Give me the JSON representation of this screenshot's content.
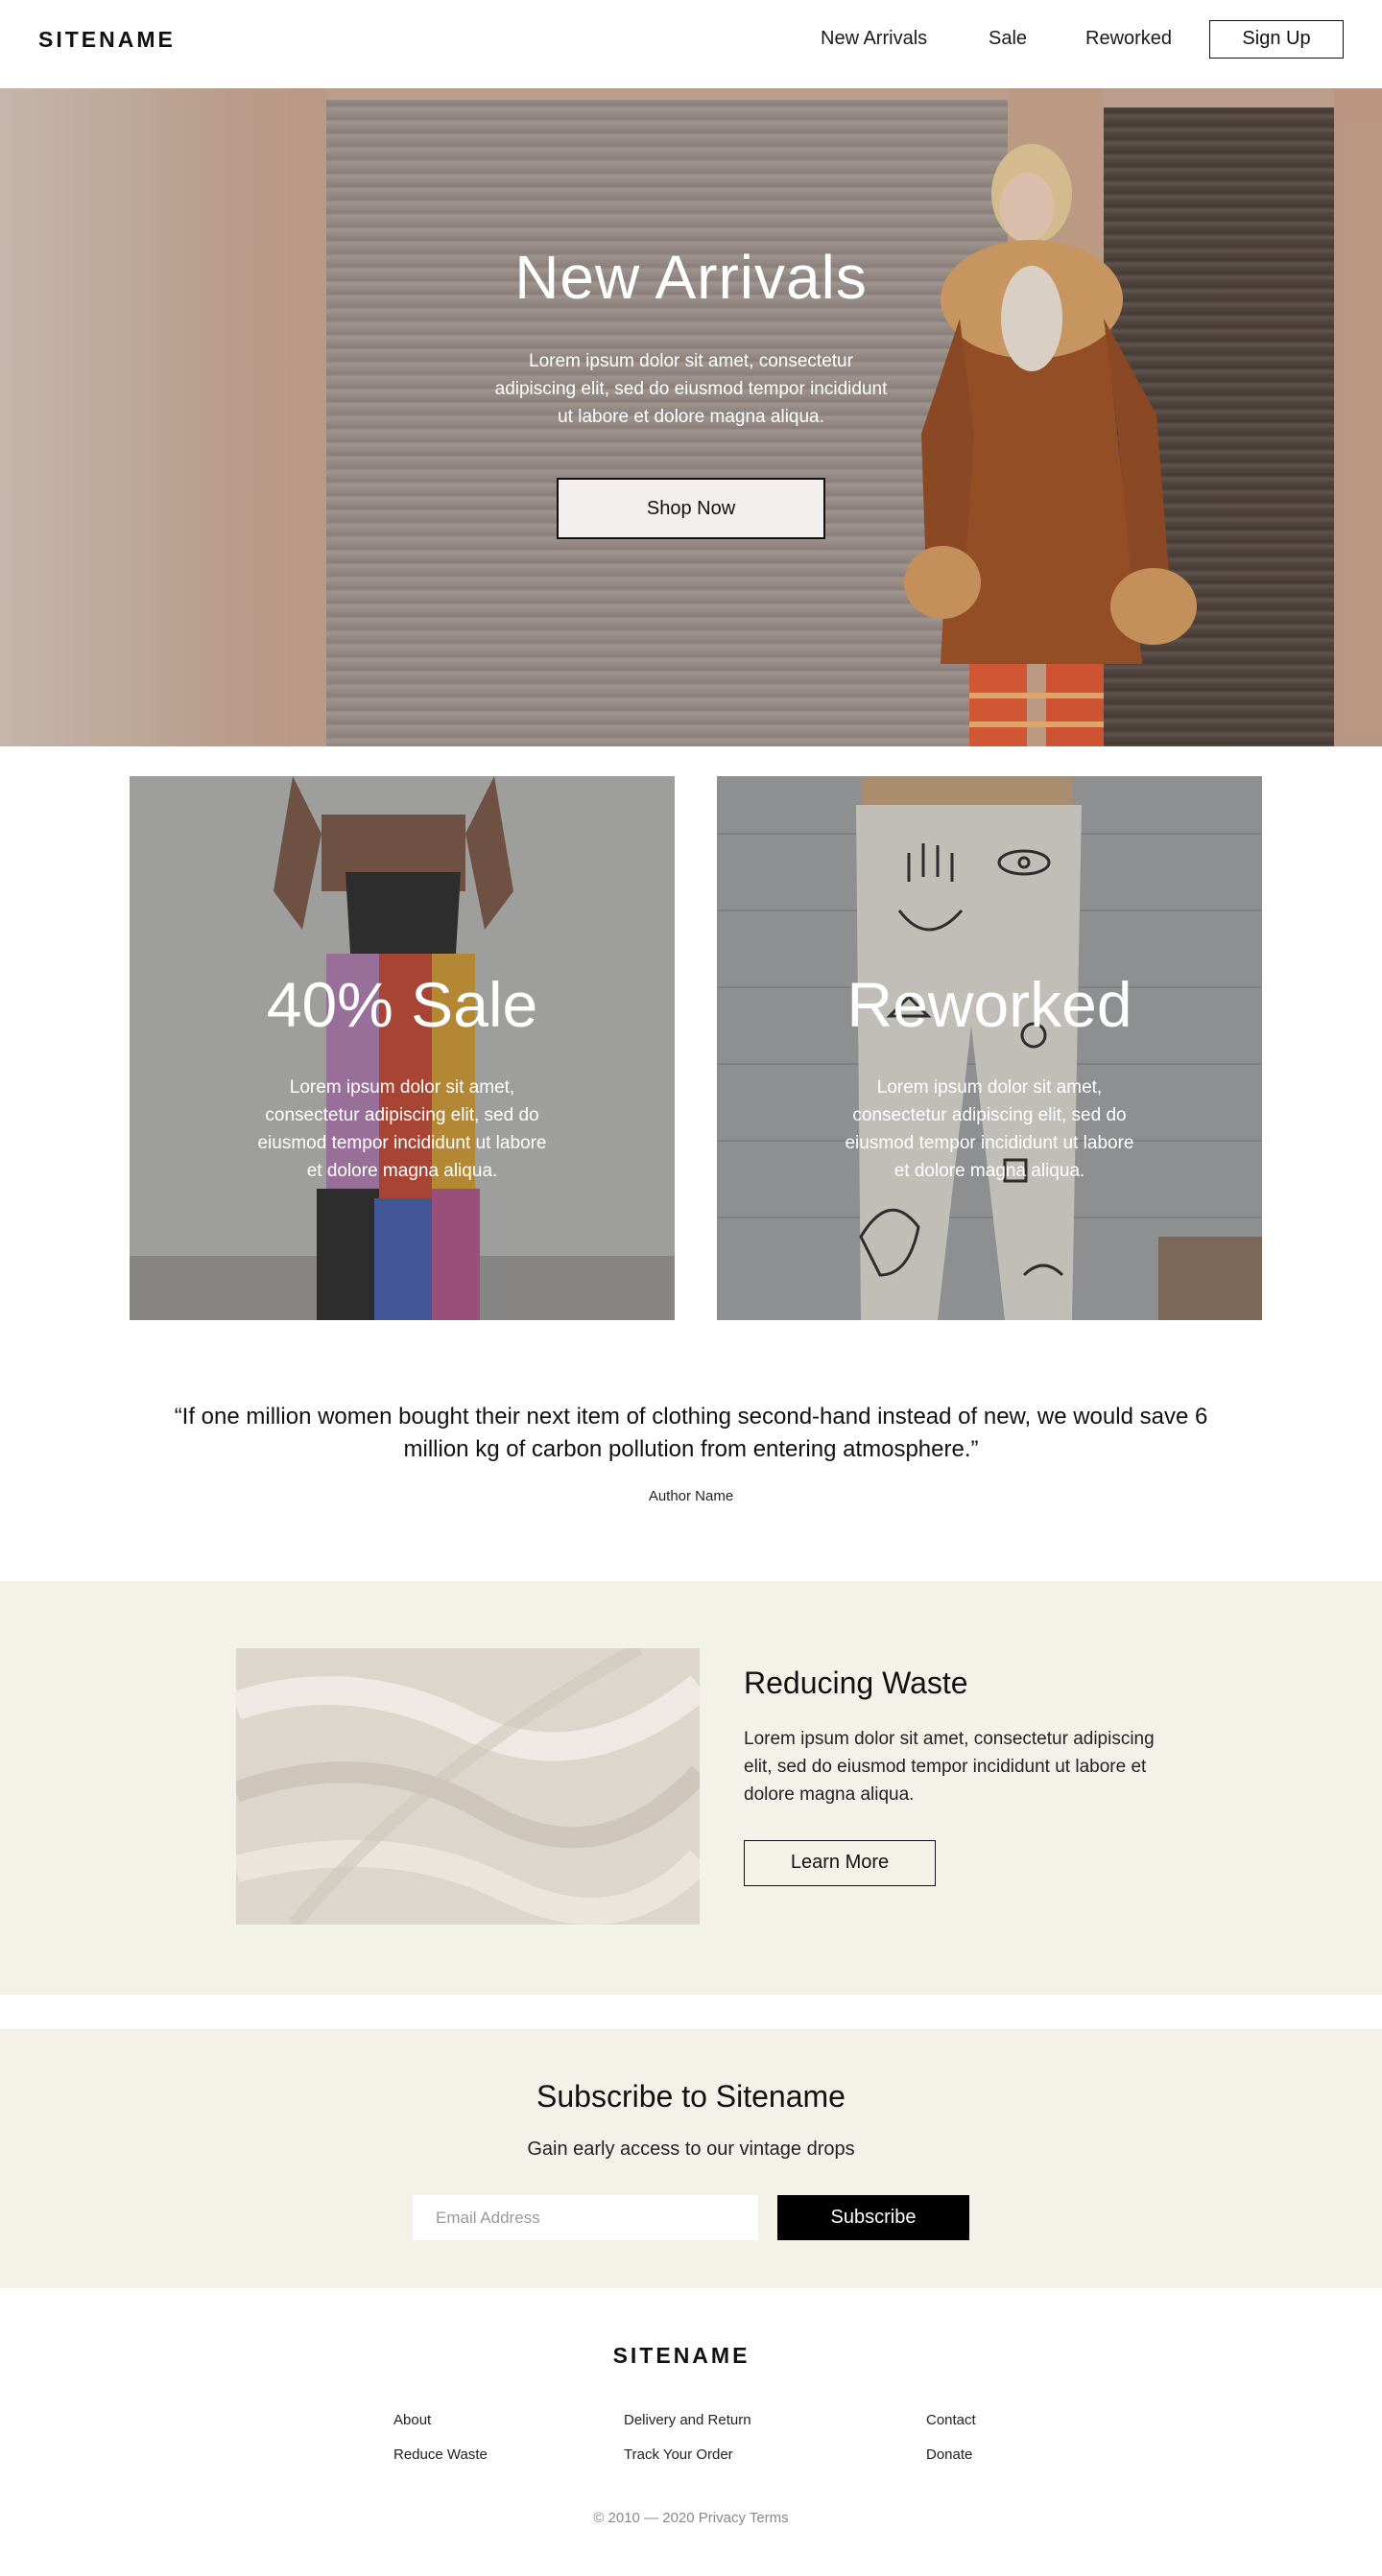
{
  "header": {
    "logo": "SITENAME",
    "nav": [
      "New Arrivals",
      "Sale",
      "Reworked"
    ],
    "signup_label": "Sign Up"
  },
  "hero": {
    "title": "New Arrivals",
    "text": "Lorem ipsum dolor sit amet, consectetur adipiscing elit, sed do eiusmod tempor incididunt ut labore et dolore magna aliqua.",
    "button_label": "Shop Now"
  },
  "cards": [
    {
      "title": "40% Sale",
      "text": "Lorem ipsum dolor sit amet, consectetur adipiscing elit, sed do eiusmod tempor incididunt ut labore et dolore magna aliqua."
    },
    {
      "title": "Reworked",
      "text": "Lorem ipsum dolor sit amet, consectetur adipiscing elit, sed do eiusmod tempor incididunt ut labore et dolore magna aliqua."
    }
  ],
  "quote": {
    "text": "“If one million women bought their next item of clothing second-hand instead of new, we would save 6 million kg of carbon pollution from entering atmosphere.”",
    "author": "Author Name"
  },
  "waste": {
    "title": "Reducing Waste",
    "text": "Lorem ipsum dolor sit amet, consectetur adipiscing elit, sed do eiusmod tempor incididunt ut labore et dolore magna aliqua.",
    "button_label": "Learn More"
  },
  "subscribe": {
    "title": "Subscribe to Sitename",
    "text": "Gain early access to our vintage drops",
    "email_placeholder": "Email Address",
    "button_label": "Subscribe"
  },
  "footer": {
    "logo": "SITENAME",
    "links": {
      "about": "About",
      "reduce_waste": "Reduce Waste",
      "delivery": "Delivery and Return",
      "track": "Track Your Order",
      "contact": "Contact",
      "donate": "Donate"
    },
    "copyright": "© 2010 — 2020 Privacy Terms"
  },
  "colors": {
    "accent_bg": "#f4f1e9",
    "button_dark": "#000000"
  }
}
